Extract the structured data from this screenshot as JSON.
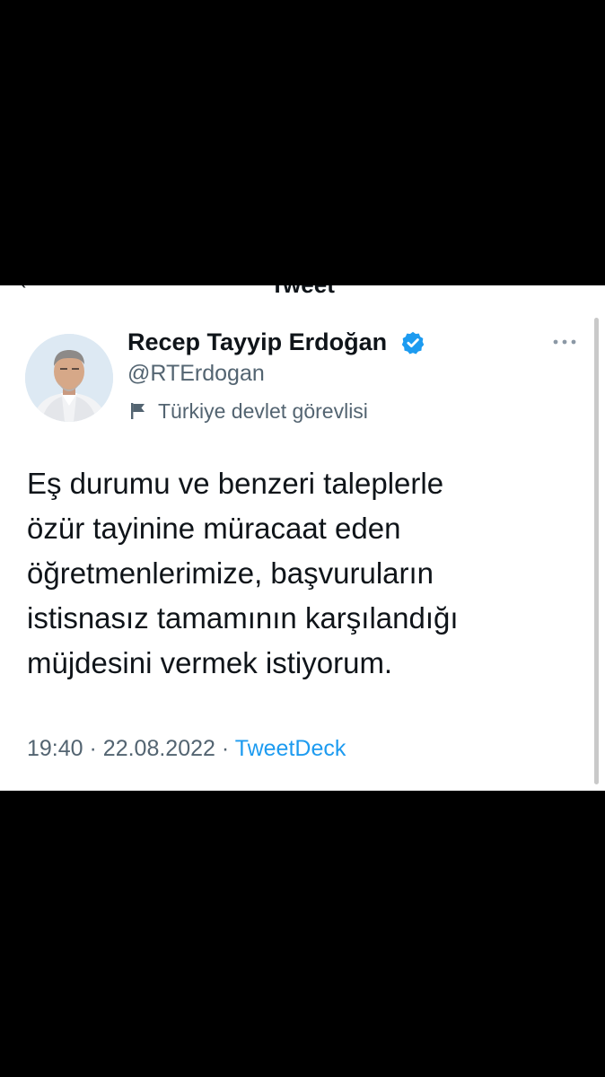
{
  "header": {
    "back_glyph": "‹",
    "title": "Tweet"
  },
  "tweet": {
    "author": {
      "display_name": "Recep Tayyip Erdoğan",
      "handle": "@RTErdogan",
      "verified": true,
      "label_icon": "flag-icon",
      "label": "Türkiye devlet görevlisi"
    },
    "more_icon": "more-icon",
    "text_lines": [
      "Eş durumu ve benzeri taleplerle",
      "özür tayinine müracaat eden",
      "öğretmenlerimize, başvuruların",
      "istisnasız tamamının karşılandığı",
      "müjdesini vermek istiyorum."
    ],
    "time": "19:40",
    "separator": "·",
    "date": "22.08.2022",
    "source": "TweetDeck"
  },
  "colors": {
    "background": "#000000",
    "card": "#ffffff",
    "text_primary": "#0f1419",
    "text_secondary": "#536471",
    "accent": "#1d9bf0"
  }
}
